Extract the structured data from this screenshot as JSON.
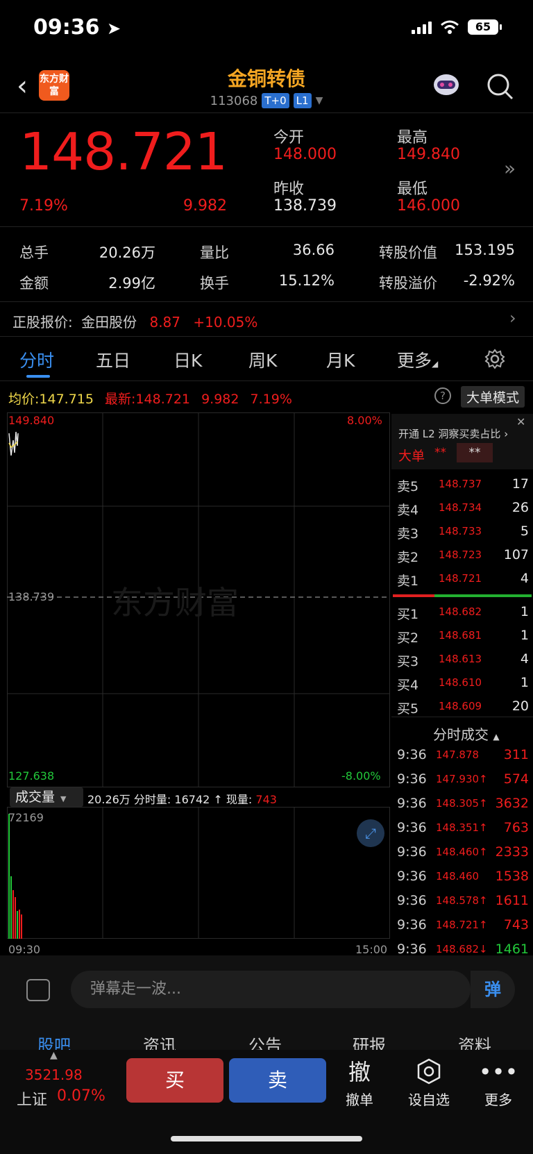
{
  "status": {
    "time": "09:36",
    "battery": "65"
  },
  "header": {
    "logo_text": "东方财富",
    "title": "金铜转债",
    "code": "113068",
    "tag1": "T+0",
    "tag2": "L1"
  },
  "quote": {
    "price": "148.721",
    "pct": "7.19%",
    "chg": "9.982",
    "open_label": "今开",
    "open": "148.000",
    "high_label": "最高",
    "high": "149.840",
    "prev_label": "昨收",
    "prev": "138.739",
    "low_label": "最低",
    "low": "146.000"
  },
  "stats": [
    {
      "label": "总手",
      "value": "20.26万"
    },
    {
      "label": "量比",
      "value": "36.66"
    },
    {
      "label": "转股价值",
      "value": "153.195"
    },
    {
      "label": "金额",
      "value": "2.99亿"
    },
    {
      "label": "换手",
      "value": "15.12%"
    },
    {
      "label": "转股溢价",
      "value": "-2.92%"
    }
  ],
  "underlying": {
    "label": "正股报价:",
    "name": "金田股份",
    "price": "8.87",
    "pct": "+10.05%"
  },
  "tabs": [
    "分时",
    "五日",
    "日K",
    "周K",
    "月K",
    "更多"
  ],
  "info": {
    "avg_label": "均价:",
    "avg": "147.715",
    "latest_label": "最新:",
    "latest": "148.721",
    "chg": "9.982",
    "pct": "7.19%",
    "help": "?",
    "bigmode": "大单模式"
  },
  "chart": {
    "top_price": "149.840",
    "top_pct": "8.00%",
    "mid_price": "138.739",
    "bot_price": "127.638",
    "bot_pct": "-8.00%",
    "watermark": "东方财富"
  },
  "volume": {
    "selector": "成交量",
    "total": "20.26万",
    "tick_label": "分时量:",
    "tick": "16742",
    "now_label": "现量:",
    "now": "743",
    "max": "72169",
    "start": "09:30",
    "end": "15:00"
  },
  "l2": {
    "promo": "开通 L2 洞察买卖占比",
    "big": "大单",
    "stars1": "**",
    "stars2": "**"
  },
  "asks": [
    {
      "label": "卖5",
      "price": "148.737",
      "vol": "17"
    },
    {
      "label": "卖4",
      "price": "148.734",
      "vol": "26"
    },
    {
      "label": "卖3",
      "price": "148.733",
      "vol": "5"
    },
    {
      "label": "卖2",
      "price": "148.723",
      "vol": "107"
    },
    {
      "label": "卖1",
      "price": "148.721",
      "vol": "4"
    }
  ],
  "bids": [
    {
      "label": "买1",
      "price": "148.682",
      "vol": "1"
    },
    {
      "label": "买2",
      "price": "148.681",
      "vol": "1"
    },
    {
      "label": "买3",
      "price": "148.613",
      "vol": "4"
    },
    {
      "label": "买4",
      "price": "148.610",
      "vol": "1"
    },
    {
      "label": "买5",
      "price": "148.609",
      "vol": "20"
    }
  ],
  "trades_title": "分时成交",
  "trades": [
    {
      "time": "9:36",
      "price": "147.878",
      "vol": "311"
    },
    {
      "time": "9:36",
      "price": "147.930↑",
      "vol": "574"
    },
    {
      "time": "9:36",
      "price": "148.305↑",
      "vol": "3632"
    },
    {
      "time": "9:36",
      "price": "148.351↑",
      "vol": "763"
    },
    {
      "time": "9:36",
      "price": "148.460↑",
      "vol": "2333"
    },
    {
      "time": "9:36",
      "price": "148.460",
      "vol": "1538"
    },
    {
      "time": "9:36",
      "price": "148.578↑",
      "vol": "1611"
    },
    {
      "time": "9:36",
      "price": "148.721↑",
      "vol": "743"
    },
    {
      "time": "9:36",
      "price": "148.682↓",
      "vol": "1461"
    }
  ],
  "comment": {
    "placeholder": "弹幕走一波...",
    "btn": "弹"
  },
  "bottom_tabs": [
    "股吧",
    "资讯",
    "公告",
    "研报",
    "资料"
  ],
  "index": {
    "value": "3521.98",
    "name": "上证",
    "pct": "0.07%"
  },
  "toolbar": {
    "buy": "买",
    "sell": "卖",
    "cancel_icon": "撤",
    "cancel": "撤单",
    "watch": "设自选",
    "more": "更多"
  }
}
